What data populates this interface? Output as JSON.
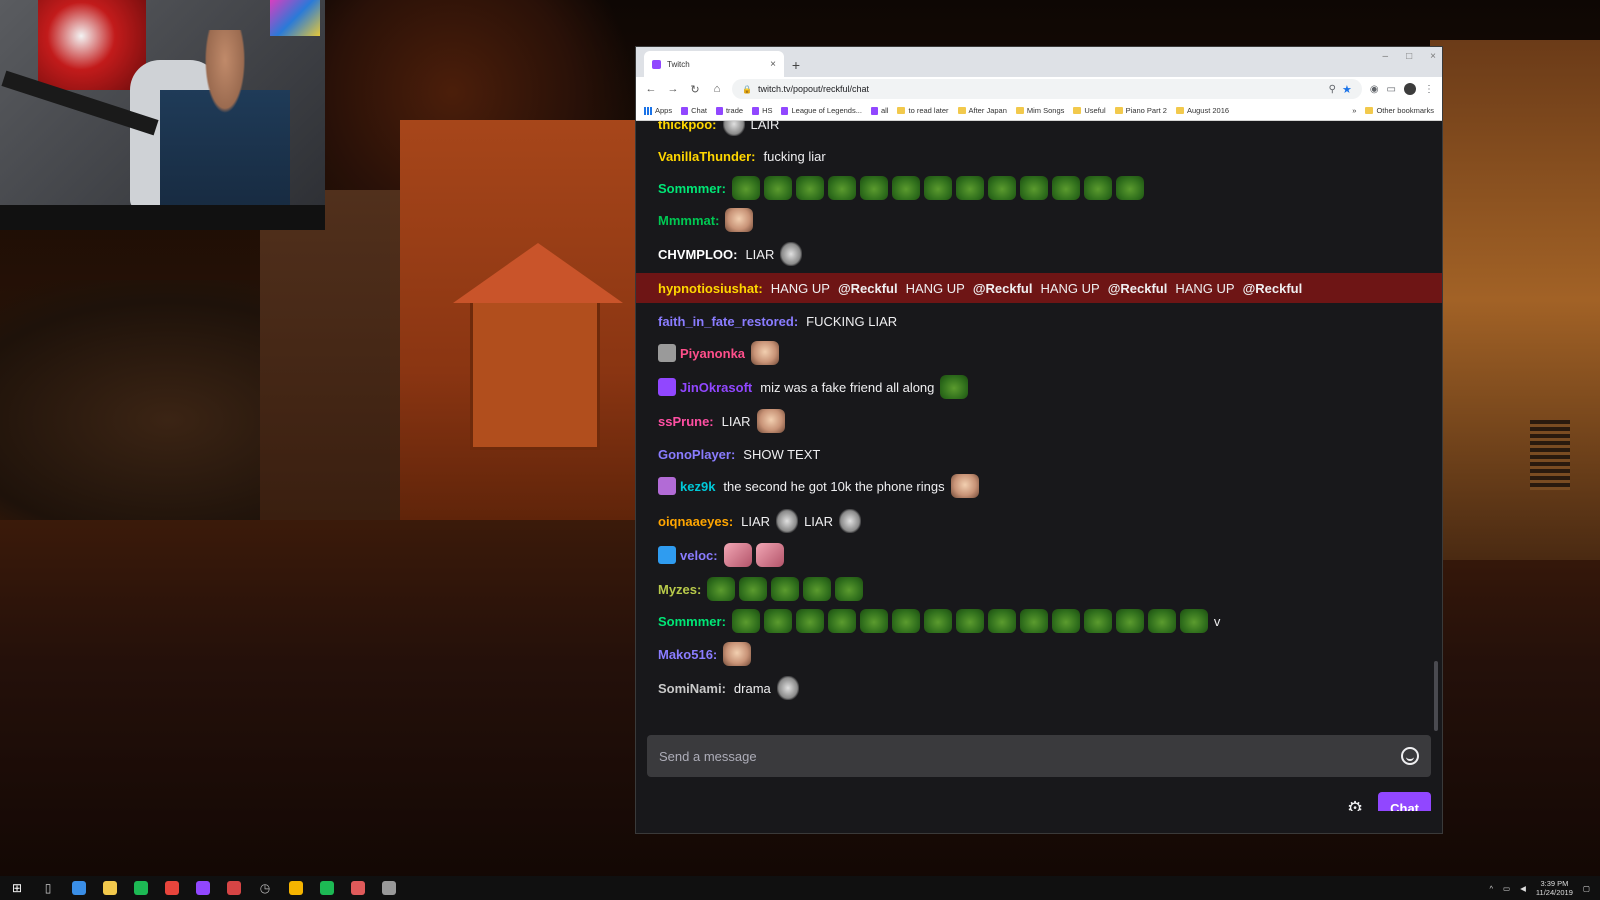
{
  "browser": {
    "tab_title": "Twitch",
    "tab_close": "×",
    "new_tab": "+",
    "url": "twitch.tv/popout/reckful/chat",
    "window_controls": [
      "–",
      "□",
      "×"
    ],
    "bookmarks": [
      {
        "label": "Apps",
        "icon": "apps-grid-icon"
      },
      {
        "label": "Chat",
        "icon": "twitch-icon"
      },
      {
        "label": "trade",
        "icon": "trade-icon"
      },
      {
        "label": "HS",
        "icon": "twitch-icon"
      },
      {
        "label": "League of Legends...",
        "icon": "twitch-icon"
      },
      {
        "label": "all",
        "icon": "twitch-icon"
      },
      {
        "label": "to read later",
        "icon": "folder-icon"
      },
      {
        "label": "After Japan",
        "icon": "folder-icon"
      },
      {
        "label": "Mim Songs",
        "icon": "folder-icon"
      },
      {
        "label": "Useful",
        "icon": "folder-icon"
      },
      {
        "label": "Piano Part 2",
        "icon": "folder-icon"
      },
      {
        "label": "August 2016",
        "icon": "folder-icon"
      }
    ],
    "bookmarks_overflow": "»",
    "other_bookmarks": "Other bookmarks"
  },
  "chat": {
    "messages": [
      {
        "user": "thickpoo:",
        "color": "#ffd700",
        "parts": [
          {
            "emote": "ghost"
          },
          {
            "text": "LAIR"
          }
        ]
      },
      {
        "user": "VanillaThunder:",
        "color": "#ffd700",
        "parts": [
          {
            "text": "fucking liar"
          }
        ]
      },
      {
        "user": "Sommmer:",
        "color": "#00e676",
        "parts": [
          {
            "emote": "frog"
          },
          {
            "emote": "frog"
          },
          {
            "emote": "frog"
          },
          {
            "emote": "frog"
          },
          {
            "emote": "frog"
          },
          {
            "emote": "frog"
          },
          {
            "emote": "frog"
          },
          {
            "emote": "frog"
          },
          {
            "emote": "frog"
          },
          {
            "emote": "frog"
          },
          {
            "emote": "frog"
          },
          {
            "emote": "frog"
          },
          {
            "emote": "frog"
          }
        ]
      },
      {
        "user": "Mmmmat:",
        "color": "#00c853",
        "parts": [
          {
            "emote": "face"
          }
        ]
      },
      {
        "user": "CHVMPLOO:",
        "color": "#ffffff",
        "parts": [
          {
            "text": "LIAR"
          },
          {
            "emote": "ghost"
          }
        ]
      },
      {
        "user": "hypnotiosiushat:",
        "color": "#ffd700",
        "highlight": true,
        "parts": [
          {
            "text": "HANG UP"
          },
          {
            "mention": "@Reckful"
          },
          {
            "text": "HANG UP"
          },
          {
            "mention": "@Reckful"
          },
          {
            "text": "HANG UP"
          },
          {
            "mention": "@Reckful"
          },
          {
            "text": "HANG UP"
          },
          {
            "mention": "@Reckful"
          }
        ]
      },
      {
        "user": "faith_in_fate_restored:",
        "color": "#8a7cff",
        "parts": [
          {
            "text": "FUCKING LIAR"
          }
        ]
      },
      {
        "user": "Piyanonka",
        "color": "#ff4f8b",
        "badge": "#9a9a9a",
        "parts": [
          {
            "emote": "face"
          }
        ]
      },
      {
        "user": "JinOkrasoft",
        "color": "#9147ff",
        "badge": "#9147ff",
        "parts": [
          {
            "text": "miz was a fake friend all along"
          },
          {
            "emote": "frog"
          }
        ]
      },
      {
        "user": "ssPrune:",
        "color": "#ff4fa3",
        "parts": [
          {
            "text": "LIAR"
          },
          {
            "emote": "face"
          }
        ]
      },
      {
        "user": "GonoPlayer:",
        "color": "#8a7cff",
        "parts": [
          {
            "text": "SHOW TEXT"
          }
        ]
      },
      {
        "user": "kez9k",
        "color": "#00c8d7",
        "badge": "#b26bd6",
        "parts": [
          {
            "text": "the second he got 10k the phone rings"
          },
          {
            "emote": "face"
          }
        ]
      },
      {
        "user": "oiqnaaeyes:",
        "color": "#ffa500",
        "parts": [
          {
            "text": "LIAR"
          },
          {
            "emote": "ghost"
          },
          {
            "text": "LIAR"
          },
          {
            "emote": "ghost"
          }
        ]
      },
      {
        "user": "veloc:",
        "color": "#8a7cff",
        "badge": "#2f9cf0",
        "parts": [
          {
            "emote": "pink"
          },
          {
            "emote": "pink"
          }
        ]
      },
      {
        "user": "Myzes:",
        "color": "#b7c94a",
        "parts": [
          {
            "emote": "frog"
          },
          {
            "emote": "frog"
          },
          {
            "emote": "frog"
          },
          {
            "emote": "frog"
          },
          {
            "emote": "frog"
          }
        ]
      },
      {
        "user": "Sommmer:",
        "color": "#00e676",
        "parts": [
          {
            "emote": "frog"
          },
          {
            "emote": "frog"
          },
          {
            "emote": "frog"
          },
          {
            "emote": "frog"
          },
          {
            "emote": "frog"
          },
          {
            "emote": "frog"
          },
          {
            "emote": "frog"
          },
          {
            "emote": "frog"
          },
          {
            "emote": "frog"
          },
          {
            "emote": "frog"
          },
          {
            "emote": "frog"
          },
          {
            "emote": "frog"
          },
          {
            "emote": "frog"
          },
          {
            "emote": "frog"
          },
          {
            "emote": "frog"
          },
          {
            "text": "v"
          }
        ]
      },
      {
        "user": "Mako516:",
        "color": "#8a7cff",
        "parts": [
          {
            "emote": "face"
          }
        ]
      },
      {
        "user": "SomiNami:",
        "color": "#c9c9c9",
        "parts": [
          {
            "text": "drama"
          },
          {
            "emote": "ghost"
          }
        ]
      }
    ],
    "input_placeholder": "Send a message",
    "chat_button": "Chat",
    "accent": "#9147ff"
  },
  "taskbar": {
    "apps": [
      "windows-start-icon",
      "task-view-icon",
      "store-icon",
      "file-explorer-icon",
      "app-green-icon",
      "chrome-icon",
      "twitch-app-icon",
      "app-red-icon",
      "app-clock-icon",
      "app-yellow-icon",
      "spotify-icon",
      "app-misc-icon",
      "app-gray-icon"
    ],
    "time": "3:39 PM",
    "date": "11/24/2019"
  }
}
